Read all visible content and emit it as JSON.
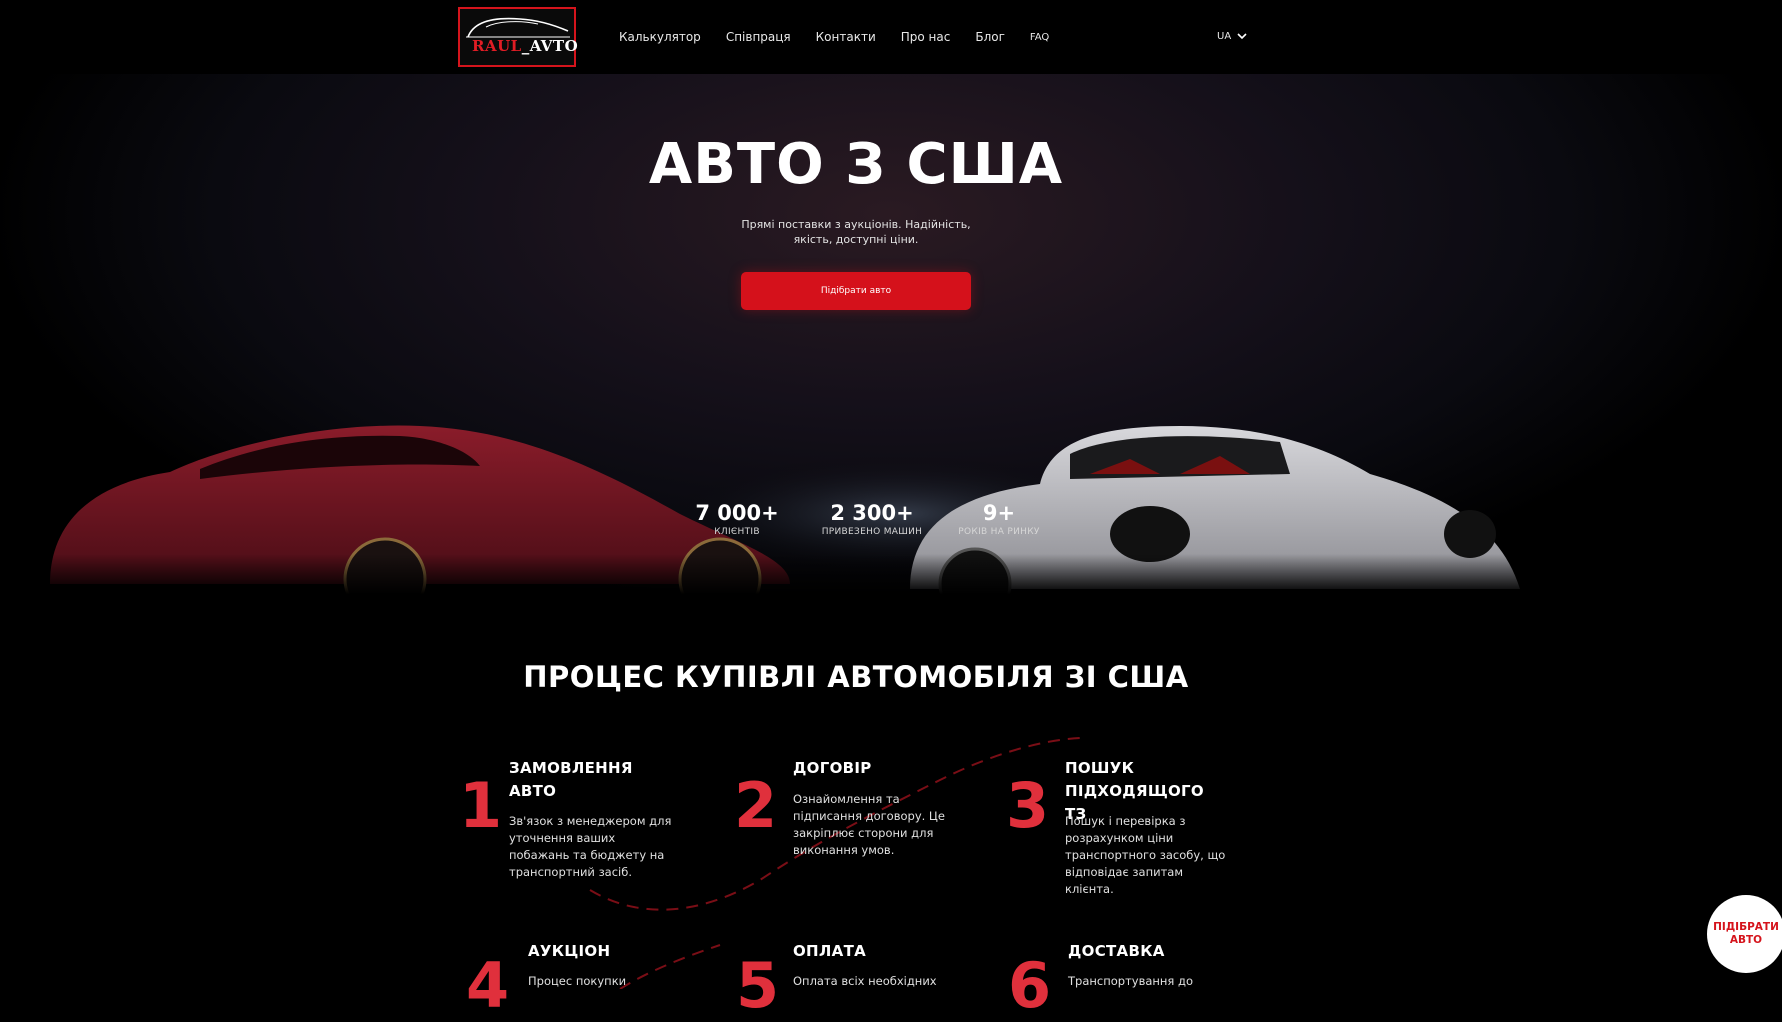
{
  "nav": {
    "logo": {
      "part1": "RAUL",
      "part2": "_AVTO"
    },
    "menu": [
      {
        "label": "Калькулятор"
      },
      {
        "label": "Співпраця"
      },
      {
        "label": "Контакти"
      },
      {
        "label": "Про нас"
      },
      {
        "label": "Блог"
      },
      {
        "label": "FAQ"
      }
    ],
    "language": "UA"
  },
  "hero": {
    "title": "АВТО З США",
    "subtitle_line1": "Прямі поставки з аукціонів. Надійність,",
    "subtitle_line2": "якість, доступні ціни.",
    "cta": "Підібрати авто",
    "stats": [
      {
        "number": "7 000+",
        "label": "КЛІЄНТІВ"
      },
      {
        "number": "2 300+",
        "label": "ПРИВЕЗЕНО МАШИН"
      },
      {
        "number": "9+",
        "label": "РОКІВ НА РИНКУ"
      }
    ]
  },
  "process": {
    "title": "ПРОЦЕС КУПІВЛІ АВТОМОБІЛЯ ЗІ США",
    "steps": [
      {
        "number": "1",
        "title_line1": "ЗАМОВЛЕННЯ",
        "title_line2": "АВТО",
        "desc": [
          "Зв'язок з менеджером для",
          "уточнення ваших",
          "побажань та бюджету на",
          "транспортний засіб."
        ]
      },
      {
        "number": "2",
        "title_line1": "ДОГОВІР",
        "title_line2": "",
        "desc": [
          "Ознайомлення та",
          "підписання договору. Це",
          "закріплює сторони для",
          "виконання умов."
        ]
      },
      {
        "number": "3",
        "title_line1": "ПОШУК",
        "title_line2": "ПІДХОДЯЩОГО ТЗ",
        "desc": [
          "Пошук і перевірка з",
          "розрахунком ціни",
          "транспортного засобу, що",
          "відповідає запитам",
          "клієнта."
        ]
      },
      {
        "number": "4",
        "title_line1": "АУКЦІОН",
        "title_line2": "",
        "desc": [
          "Процес покупки"
        ]
      },
      {
        "number": "5",
        "title_line1": "ОПЛАТА",
        "title_line2": "",
        "desc": [
          "Оплата всіх необхідних"
        ]
      },
      {
        "number": "6",
        "title_line1": "ДОСТАВКА",
        "title_line2": "",
        "desc": [
          "Транспортування до"
        ]
      }
    ]
  },
  "floating_cta": {
    "line1": "ПІДІБРАТИ",
    "line2": "АВТО"
  }
}
